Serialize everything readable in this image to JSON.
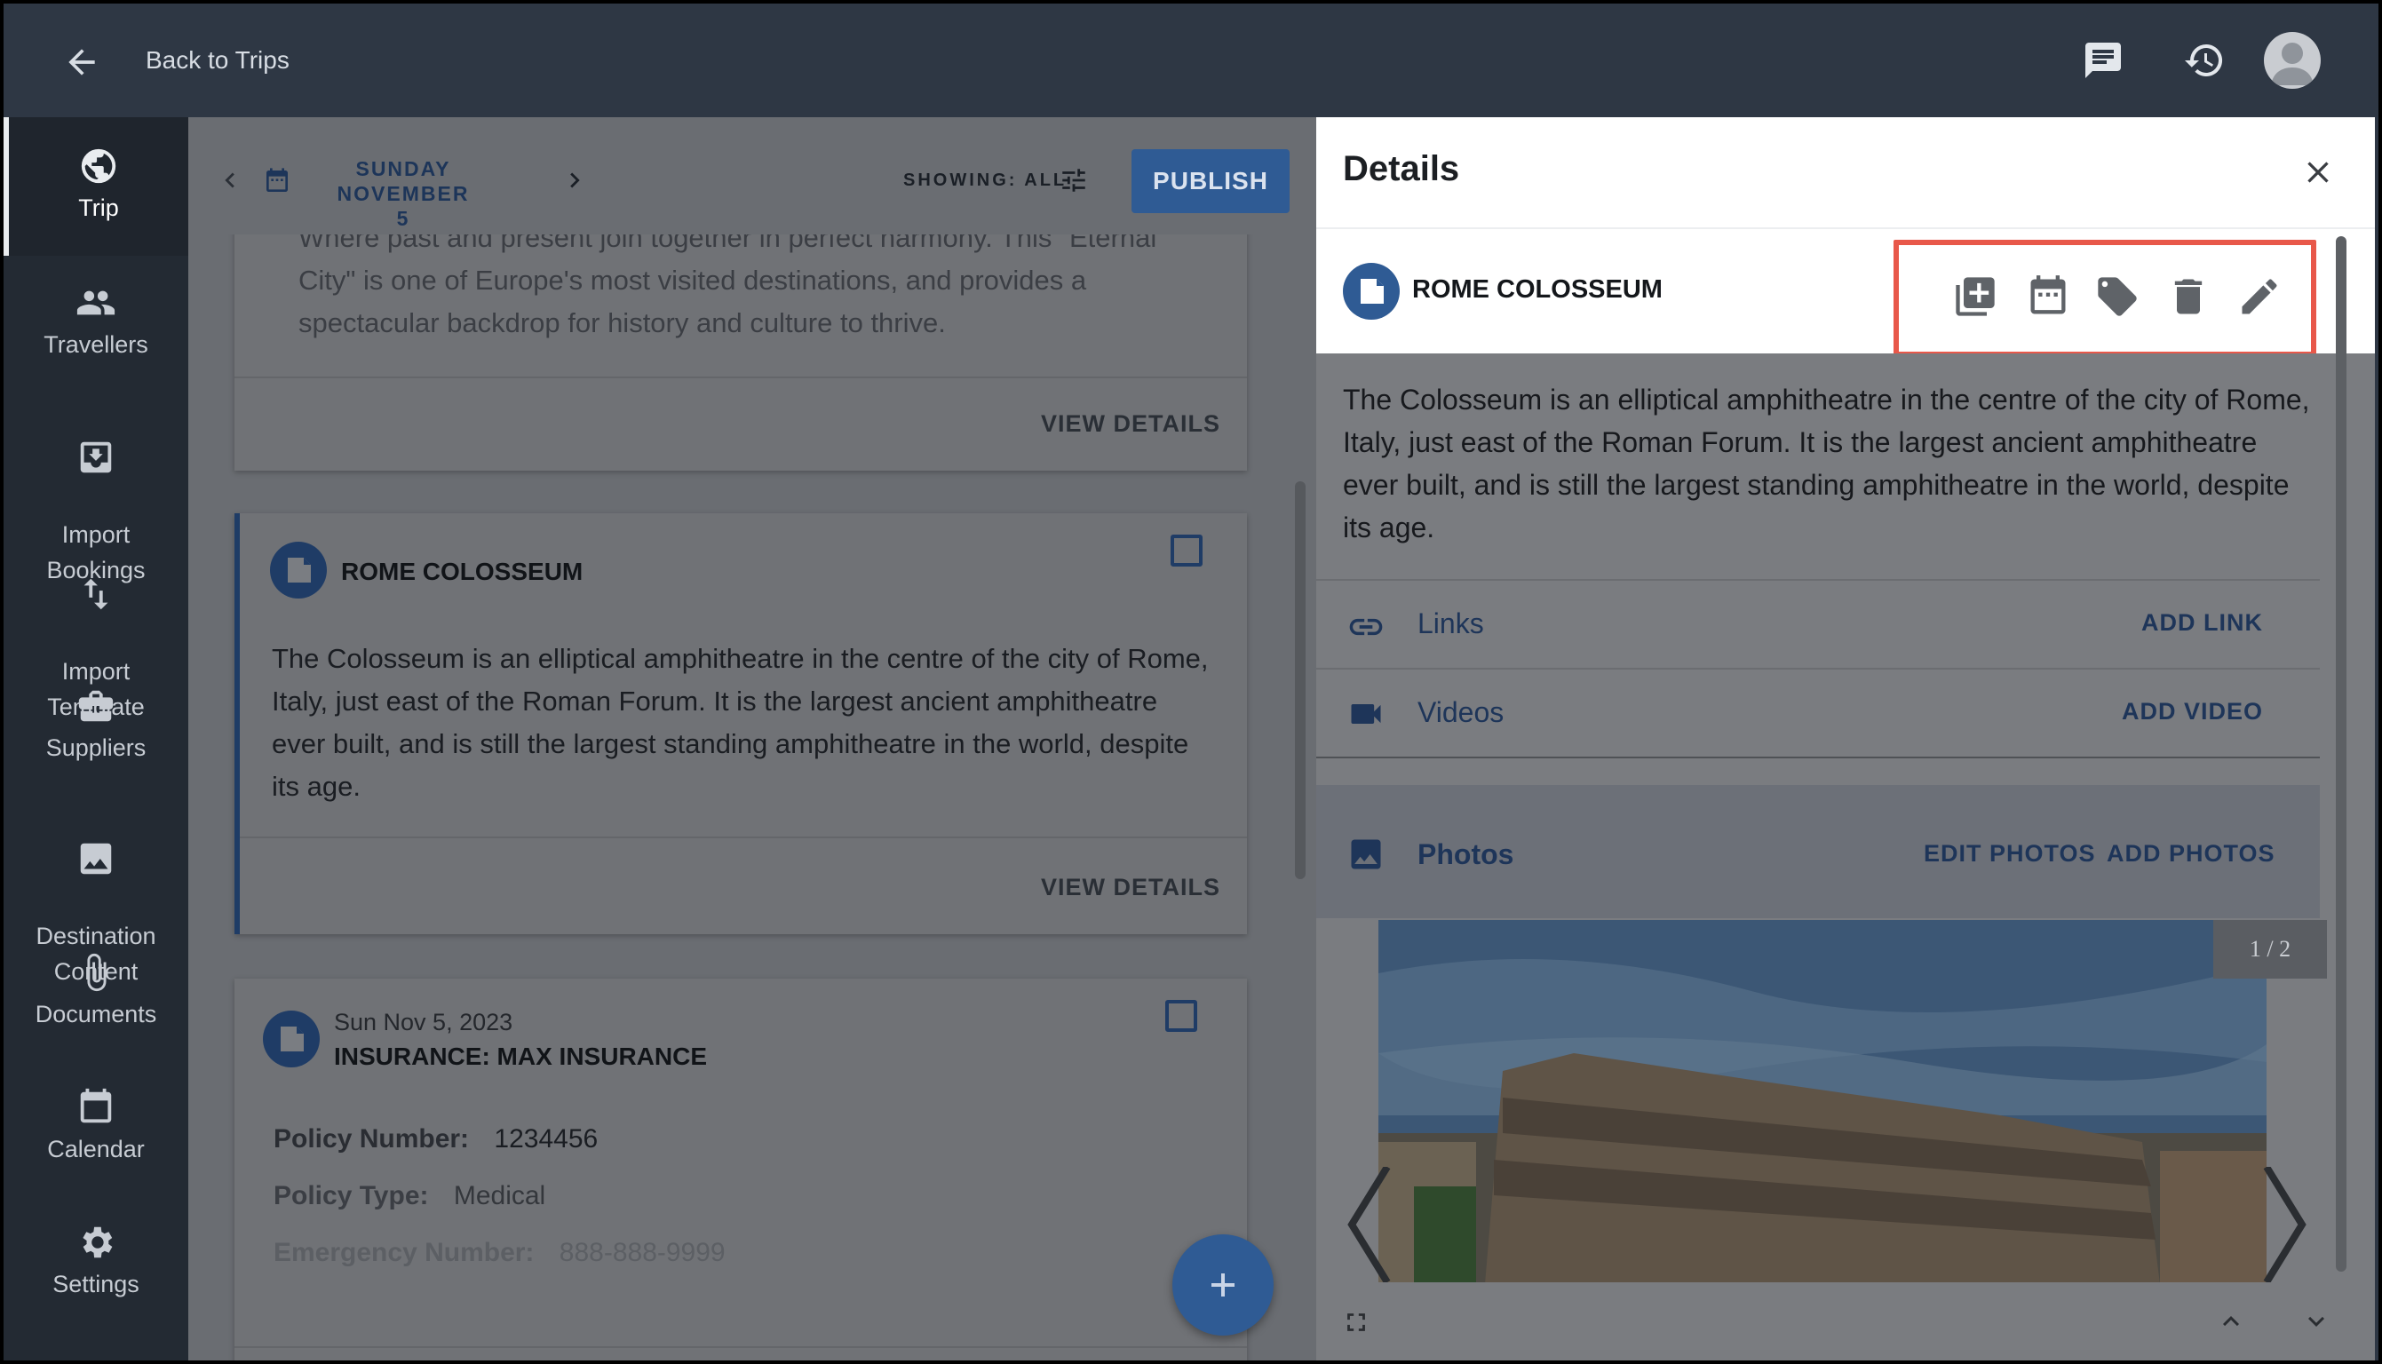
{
  "topbar": {
    "back_label": "Back to Trips"
  },
  "nav": {
    "items": [
      {
        "label": "Trip",
        "icon": "globe-icon"
      },
      {
        "label": "Travellers",
        "icon": "people-icon"
      },
      {
        "label": "Import\nBookings",
        "icon": "import-icon"
      },
      {
        "label": "Import\nTemplate",
        "icon": "swap-vertical-icon"
      },
      {
        "label": "Suppliers",
        "icon": "briefcase-icon"
      },
      {
        "label": "Destination\nContent",
        "icon": "image-icon"
      },
      {
        "label": "Documents",
        "icon": "paperclip-icon"
      },
      {
        "label": "Calendar",
        "icon": "calendar-icon"
      },
      {
        "label": "Settings",
        "icon": "gear-icon"
      }
    ]
  },
  "toolbar": {
    "date_line1": "SUNDAY NOVEMBER",
    "date_line2": "5",
    "showing": "SHOWING: ALL",
    "publish": "PUBLISH"
  },
  "cards": {
    "first": {
      "partial_line0": "Where past and present join together in perfect harmony. This \"Eternal",
      "partial_line1": "City\" is one of Europe's most visited destinations, and provides a",
      "partial_line2": "spectacular backdrop for history and culture to thrive.",
      "view_details": "VIEW DETAILS"
    },
    "colosseum": {
      "title": "ROME COLOSSEUM",
      "body": "The Colosseum is an elliptical amphitheatre in the centre of the city of Rome, Italy, just east of the Roman Forum. It is the largest ancient amphitheatre ever built, and is still the largest standing amphitheatre in the world, despite its age.",
      "view_details": "VIEW DETAILS"
    },
    "insurance": {
      "date": "Sun Nov 5, 2023",
      "title": "INSURANCE: MAX INSURANCE",
      "policy_number_label": "Policy Number:",
      "policy_number": "1234456",
      "policy_type_label": "Policy Type:",
      "policy_type": "Medical",
      "emergency_label": "Emergency Number:",
      "emergency": "888-888-9999"
    }
  },
  "details": {
    "title": "Details",
    "item_title": "ROME COLOSSEUM",
    "description": "The Colosseum is an elliptical amphitheatre in the centre of the city of Rome, Italy, just east of the Roman Forum. It is the largest ancient amphitheatre ever built, and is still the largest standing amphitheatre in the world, despite its age.",
    "links_label": "Links",
    "add_link": "ADD LINK",
    "videos_label": "Videos",
    "add_video": "ADD VIDEO",
    "photos_label": "Photos",
    "edit_photos": "EDIT PHOTOS",
    "add_photos": "ADD PHOTOS",
    "photo_counter": "1 / 2"
  },
  "colors": {
    "accent": "#2f5b94",
    "highlight": "#e8584a",
    "topbar": "#2e3744",
    "nav": "#232a33"
  }
}
